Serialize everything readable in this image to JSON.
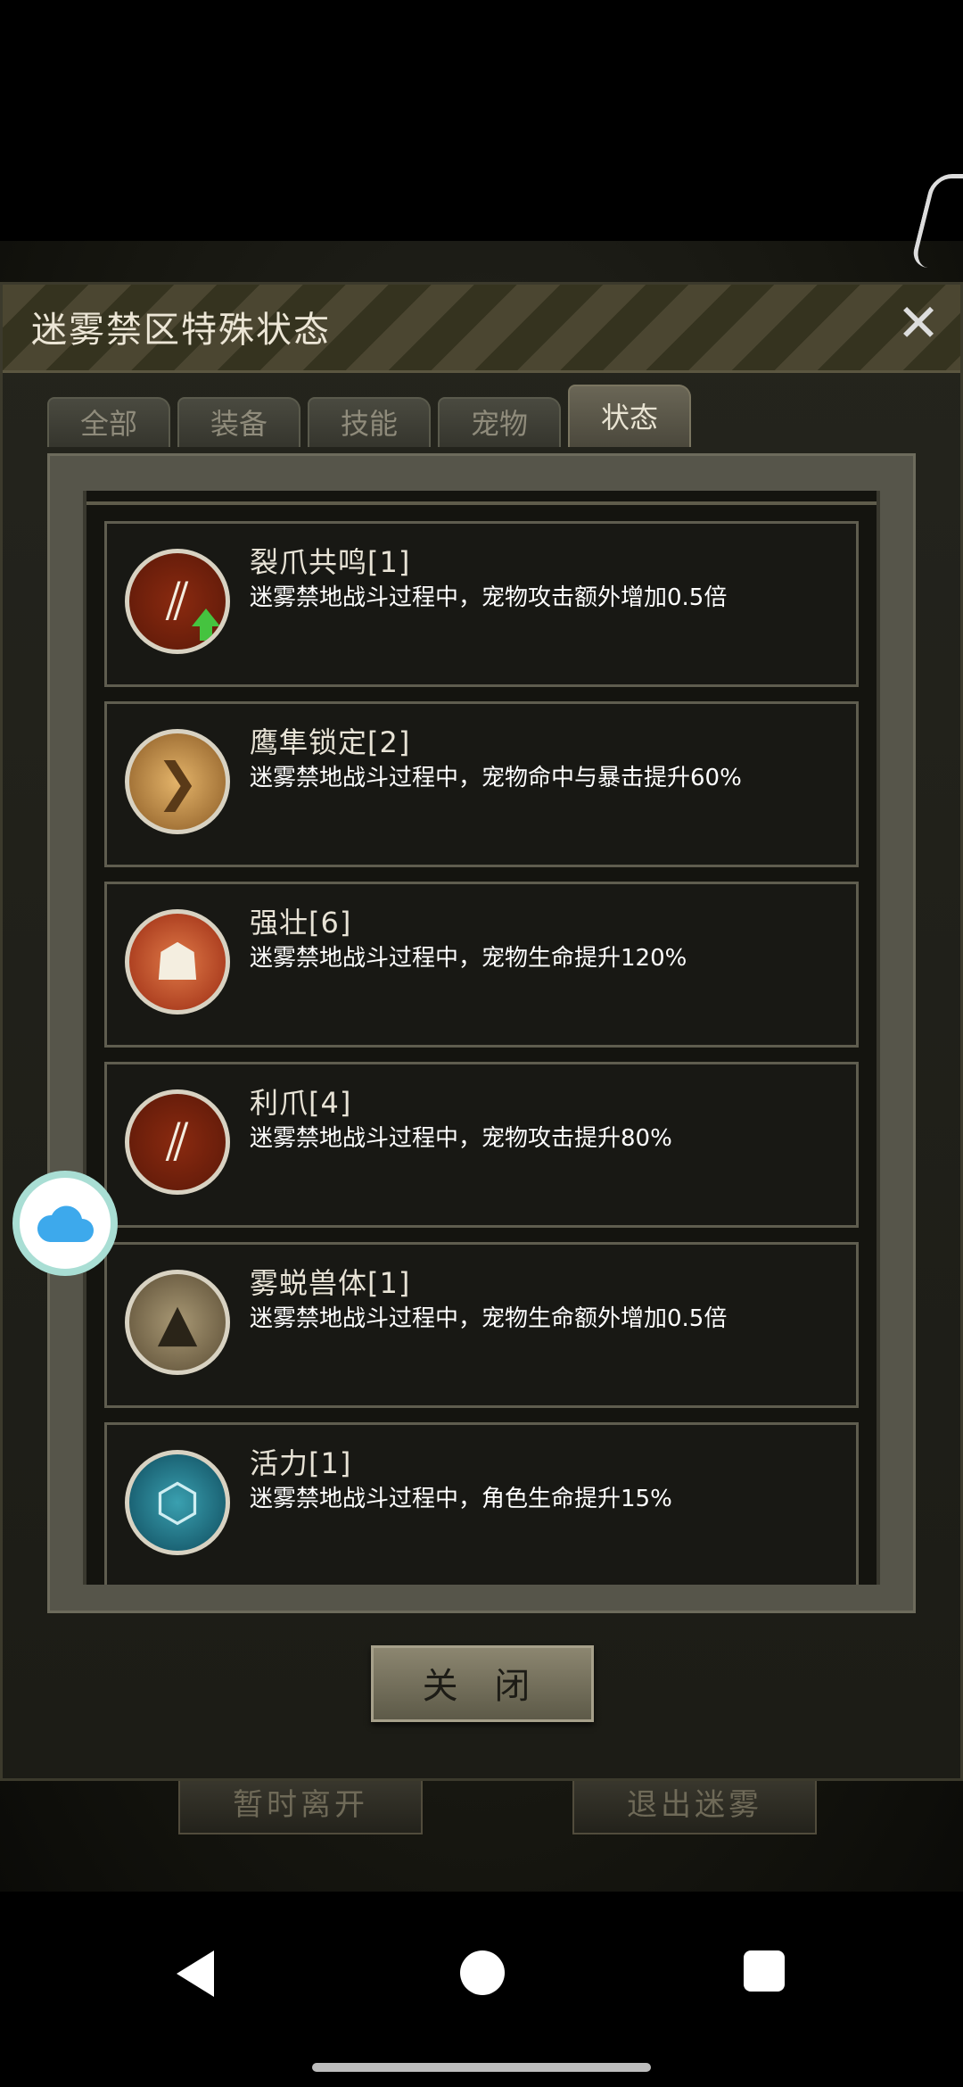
{
  "dialog": {
    "title": "迷雾禁区特殊状态"
  },
  "tabs": [
    {
      "label": "全部",
      "active": false
    },
    {
      "label": "装备",
      "active": false
    },
    {
      "label": "技能",
      "active": false
    },
    {
      "label": "宠物",
      "active": false
    },
    {
      "label": "状态",
      "active": true
    }
  ],
  "buffs": [
    {
      "name": "裂爪共鸣[1]",
      "desc": "迷雾禁地战斗过程中，宠物攻击额外增加0.5倍",
      "icon": "claw-up-icon"
    },
    {
      "name": "鹰隼锁定[2]",
      "desc": "迷雾禁地战斗过程中，宠物命中与暴击提升60%",
      "icon": "eagle-icon"
    },
    {
      "name": "强壮[6]",
      "desc": "迷雾禁地战斗过程中，宠物生命提升120%",
      "icon": "beast-roar-icon"
    },
    {
      "name": "利爪[4]",
      "desc": "迷雾禁地战斗过程中，宠物攻击提升80%",
      "icon": "claw-icon"
    },
    {
      "name": "雾蜕兽体[1]",
      "desc": "迷雾禁地战斗过程中，宠物生命额外增加0.5倍",
      "icon": "wolf-icon"
    },
    {
      "name": "活力[1]",
      "desc": "迷雾禁地战斗过程中，角色生命提升15%",
      "icon": "molecule-icon"
    }
  ],
  "close_button": "关 闭",
  "under_buttons": [
    "暂时离开",
    "退出迷雾"
  ]
}
